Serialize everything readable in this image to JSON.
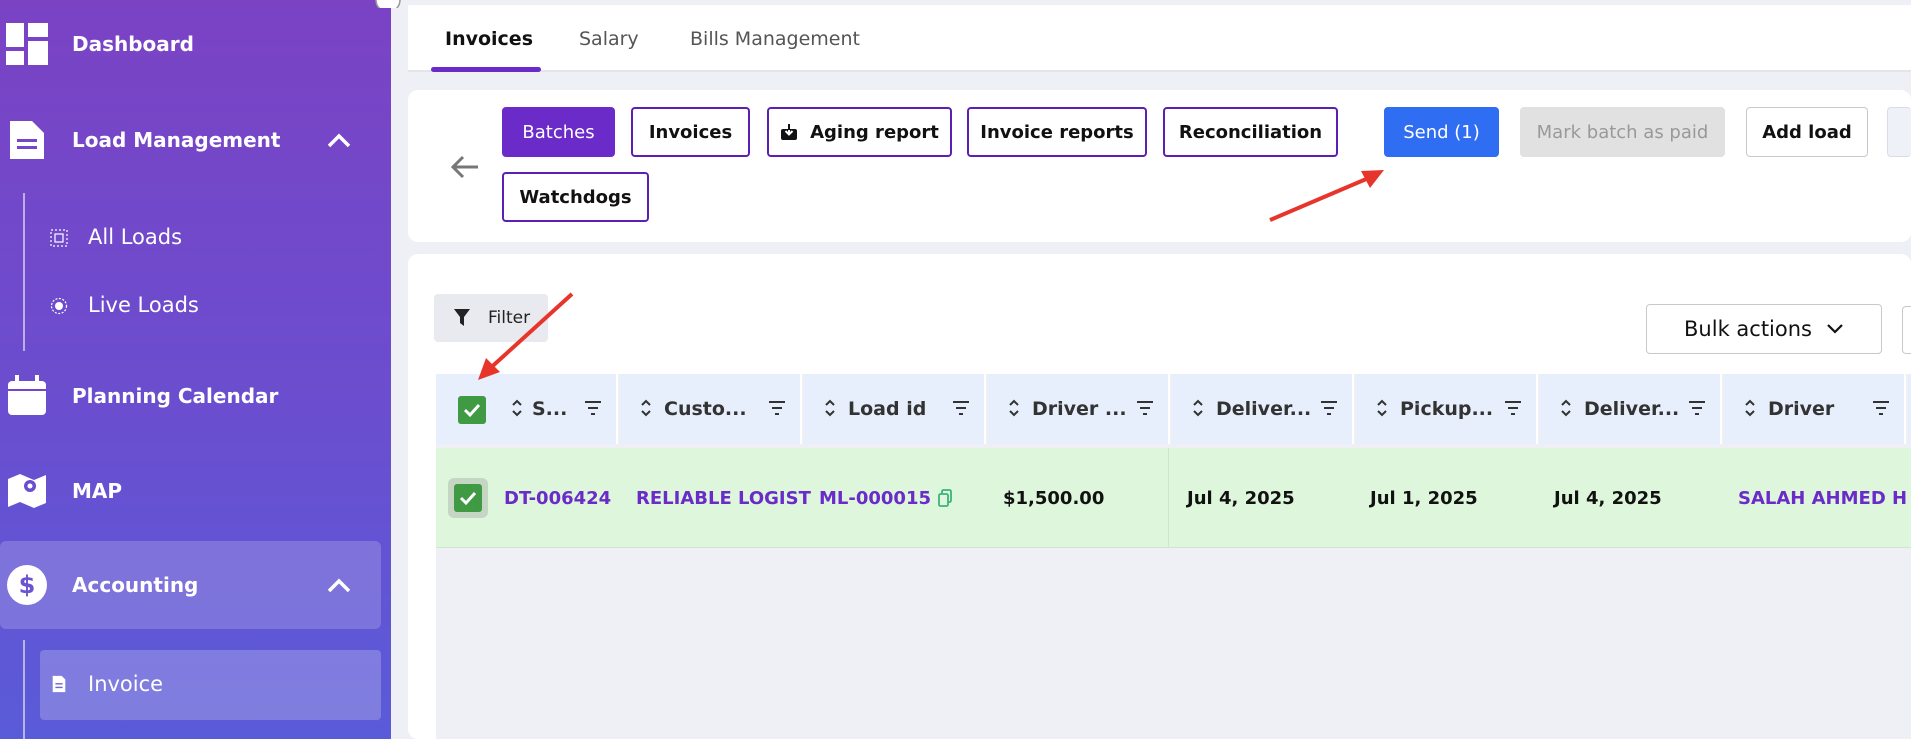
{
  "sidebar": {
    "items": [
      {
        "label": "Dashboard",
        "icon": "dashboard-icon"
      },
      {
        "label": "Load Management",
        "icon": "document-icon"
      },
      {
        "label": "Planning Calendar",
        "icon": "calendar-icon"
      },
      {
        "label": "MAP",
        "icon": "map-icon"
      },
      {
        "label": "Accounting",
        "icon": "dollar-icon"
      }
    ],
    "load_sub": [
      {
        "label": "All Loads",
        "icon": "square-dots-icon"
      },
      {
        "label": "Live Loads",
        "icon": "radio-dot-icon"
      }
    ],
    "accounting_sub": [
      {
        "label": "Invoice",
        "icon": "invoice-icon"
      }
    ]
  },
  "tabs": [
    {
      "label": "Invoices",
      "active": true
    },
    {
      "label": "Salary"
    },
    {
      "label": "Bills Management"
    }
  ],
  "toolbar": {
    "buttons": [
      {
        "label": "Batches"
      },
      {
        "label": "Invoices"
      },
      {
        "label": "Aging report"
      },
      {
        "label": "Invoice reports"
      },
      {
        "label": "Reconciliation"
      },
      {
        "label": "Watchdogs"
      }
    ],
    "send_label": "Send (1)",
    "mark_paid_label": "Mark batch as paid",
    "add_load_label": "Add load"
  },
  "table": {
    "filter_label": "Filter",
    "bulk_actions_label": "Bulk actions",
    "columns": [
      "S...",
      "Custo...",
      "Load id",
      "Driver ...",
      "Deliver...",
      "Pickup...",
      "Deliver...",
      "Driver"
    ],
    "rows": [
      {
        "batch": "DT-006424",
        "customer": "RELIABLE LOGIST",
        "load_id": "ML-000015",
        "driver_pay": "$1,500.00",
        "delivery": "Jul 4, 2025",
        "pickup": "Jul 1, 2025",
        "delivery2": "Jul 4, 2025",
        "driver": "SALAH AHMED  H"
      }
    ]
  },
  "colors": {
    "accent": "#6a2bc8",
    "send": "#2f6df2",
    "annotation": "#e8352b",
    "row_selected": "#def7dc"
  }
}
